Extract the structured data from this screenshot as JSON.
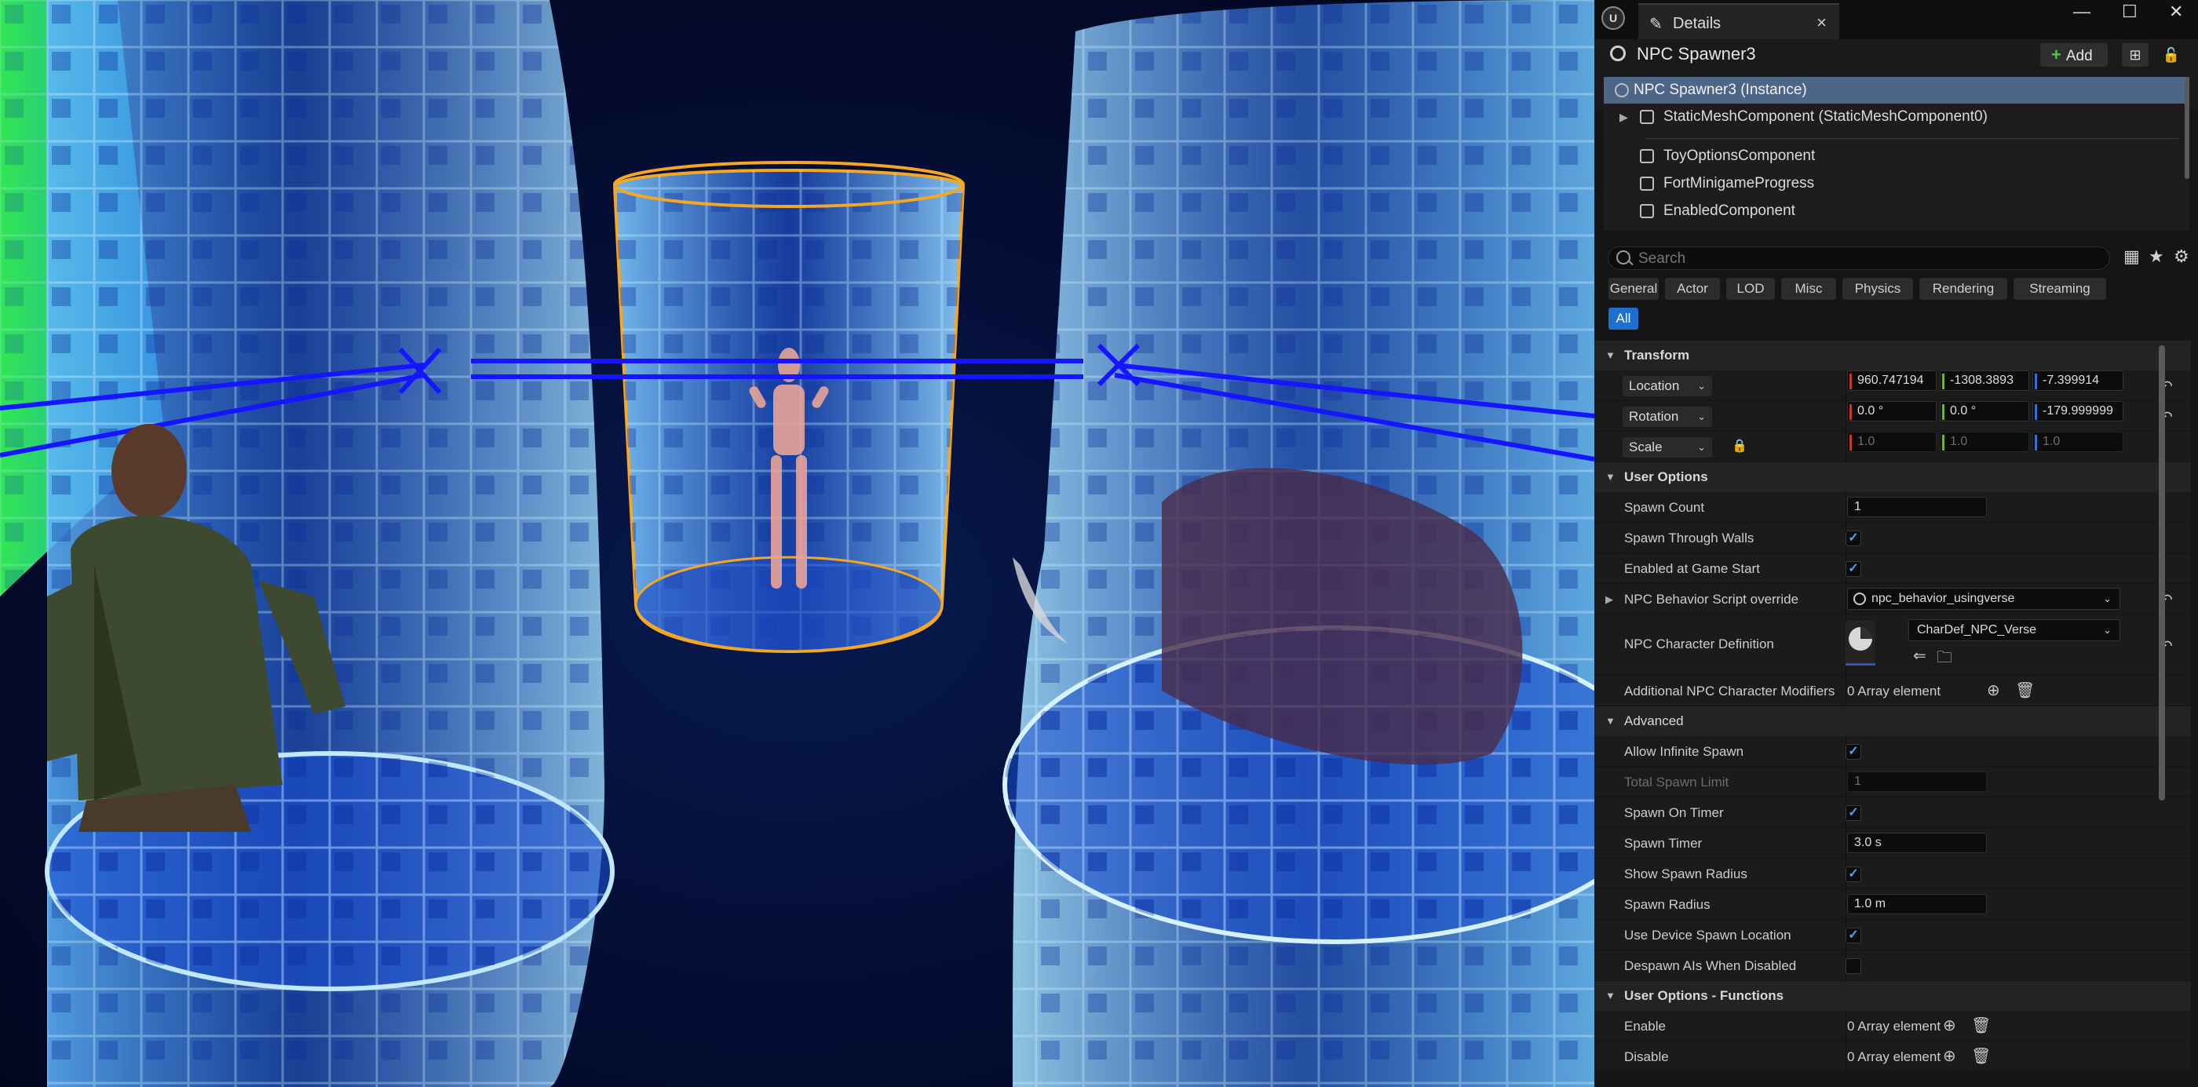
{
  "window": {
    "tab_title": "Details",
    "tab_close": "×",
    "minimize": "—",
    "maximize": "☐",
    "close": "✕"
  },
  "actor": {
    "name": "NPC Spawner3",
    "add_label": "Add"
  },
  "components": [
    {
      "label": "NPC Spawner3 (Instance)",
      "selected": true
    },
    {
      "label": "StaticMeshComponent (StaticMeshComponent0)"
    },
    {
      "label": "ToyOptionsComponent"
    },
    {
      "label": "FortMinigameProgress"
    },
    {
      "label": "EnabledComponent"
    }
  ],
  "search": {
    "placeholder": "Search"
  },
  "filters": [
    "General",
    "Actor",
    "LOD",
    "Misc",
    "Physics",
    "Rendering",
    "Streaming",
    "All"
  ],
  "transform": {
    "header": "Transform",
    "location_label": "Location",
    "location": [
      "960.747194",
      "-1308.3893",
      "-7.399914"
    ],
    "rotation_label": "Rotation",
    "rotation": [
      "0.0 °",
      "0.0 °",
      "-179.999999"
    ],
    "scale_label": "Scale",
    "scale": [
      "1.0",
      "1.0",
      "1.0"
    ]
  },
  "user_options": {
    "header": "User Options",
    "spawn_count_label": "Spawn Count",
    "spawn_count": "1",
    "spawn_through_walls_label": "Spawn Through Walls",
    "enabled_at_start_label": "Enabled at Game Start",
    "behavior_label": "NPC Behavior Script override",
    "behavior_value": "npc_behavior_usingverse",
    "chardef_label": "NPC Character Definition",
    "chardef_value": "CharDef_NPC_Verse",
    "modifiers_label": "Additional NPC Character Modifiers",
    "modifiers_value": "0 Array element"
  },
  "advanced": {
    "header": "Advanced",
    "allow_infinite_label": "Allow Infinite Spawn",
    "total_limit_label": "Total Spawn Limit",
    "total_limit": "1",
    "spawn_on_timer_label": "Spawn On Timer",
    "spawn_timer_label": "Spawn Timer",
    "spawn_timer": "3.0 s",
    "show_radius_label": "Show Spawn Radius",
    "spawn_radius_label": "Spawn Radius",
    "spawn_radius": "1.0 m",
    "use_device_loc_label": "Use Device Spawn Location",
    "despawn_label": "Despawn AIs When Disabled"
  },
  "functions": {
    "header": "User Options - Functions",
    "enable_label": "Enable",
    "enable_value": "0 Array element",
    "disable_label": "Disable",
    "disable_value": "0 Array element"
  },
  "colors": {
    "accent": "#1f6fd0",
    "selection": "#4d6688",
    "x_axis": "#c8372b",
    "y_axis": "#6fb13b",
    "z_axis": "#3a6fd8",
    "checkbox": "#4aa3ff",
    "add_plus": "#54c24a"
  }
}
